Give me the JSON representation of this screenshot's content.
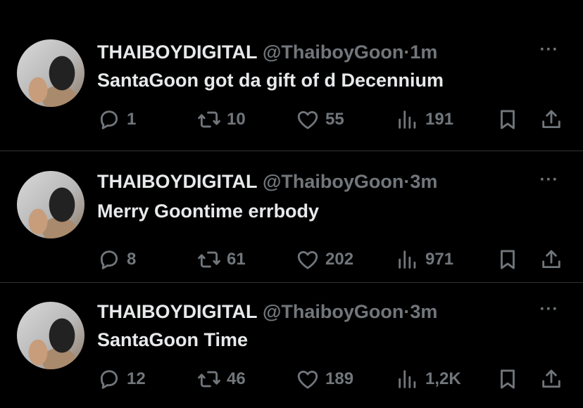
{
  "tweets": [
    {
      "name": "THAIBOYDIGITAL",
      "handle": "@ThaiboyGoon",
      "separator": "·",
      "time": "1m",
      "text": "SantaGoon got da gift of d Decennium",
      "replies": "1",
      "reposts": "10",
      "likes": "55",
      "views": "191"
    },
    {
      "name": "THAIBOYDIGITAL",
      "handle": "@ThaiboyGoon",
      "separator": "·",
      "time": "3m",
      "text": "Merry Goontime errbody",
      "replies": "8",
      "reposts": "61",
      "likes": "202",
      "views": "971"
    },
    {
      "name": "THAIBOYDIGITAL",
      "handle": "@ThaiboyGoon",
      "separator": "·",
      "time": "3m",
      "text": "SantaGoon Time",
      "replies": "12",
      "reposts": "46",
      "likes": "189",
      "views": "1,2K"
    }
  ],
  "more_label": "···",
  "colors": {
    "background": "#000000",
    "text": "#e7e9ea",
    "secondary": "#71767b",
    "divider": "#2f3336"
  },
  "icons": [
    "reply-icon",
    "repost-icon",
    "like-icon",
    "views-icon",
    "bookmark-icon",
    "share-icon",
    "more-icon"
  ]
}
